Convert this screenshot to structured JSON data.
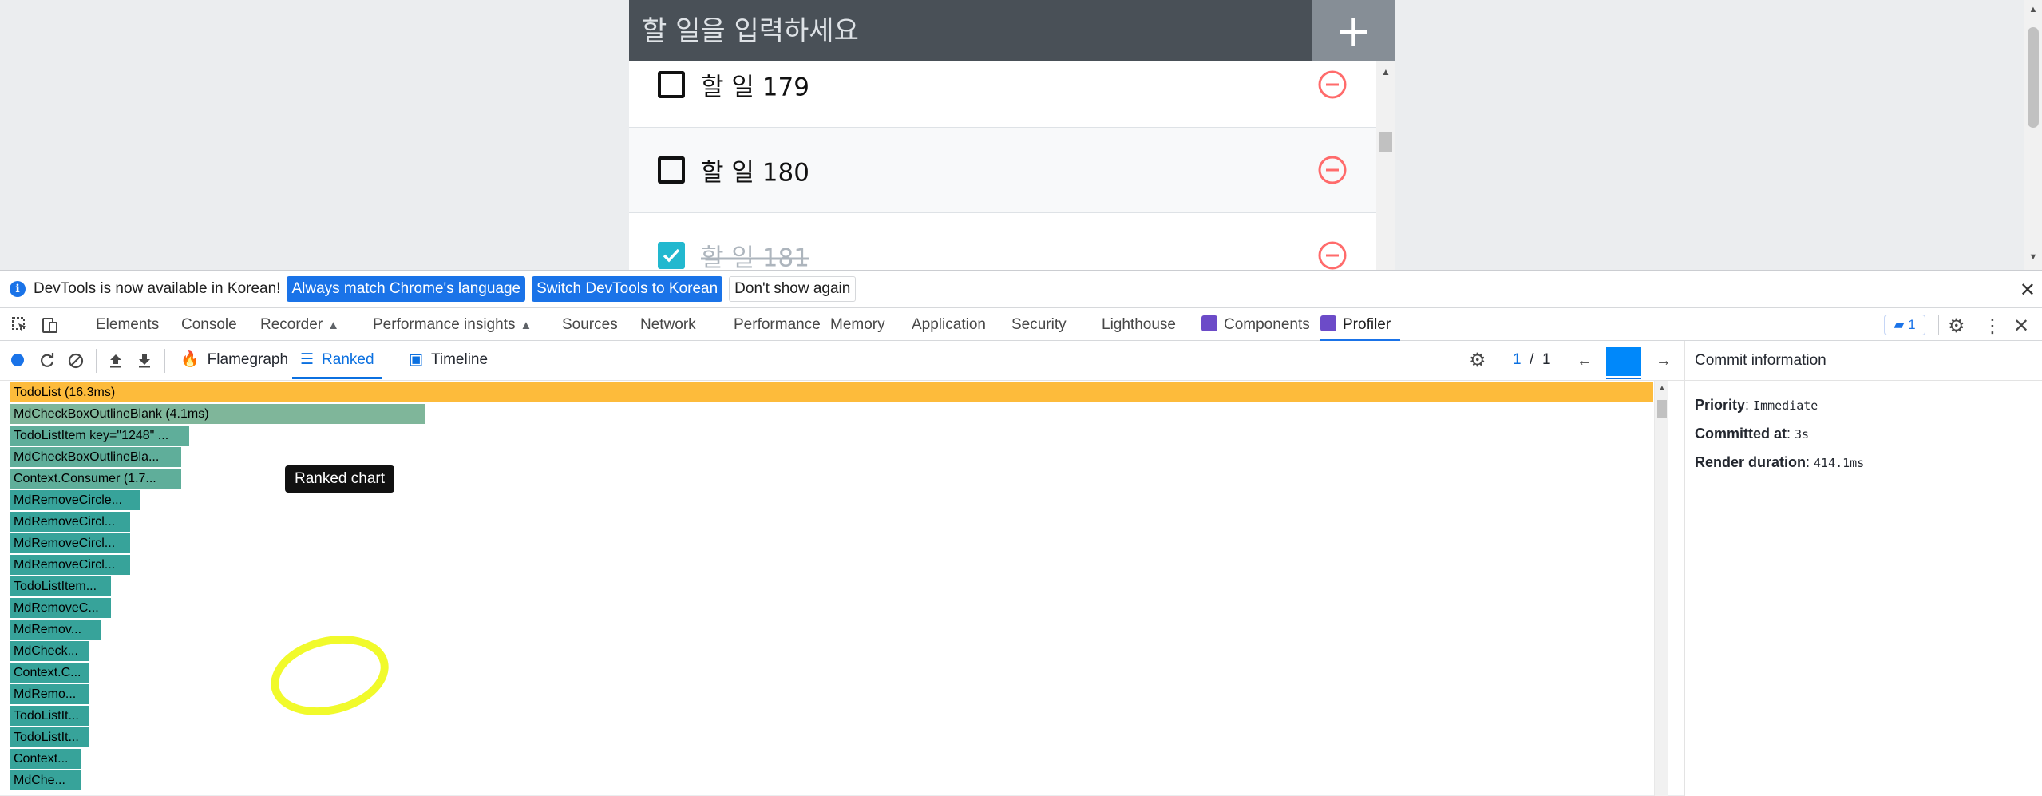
{
  "todo": {
    "placeholder": "할 일을 입력하세요",
    "add_label": "+",
    "items": [
      {
        "text": "할 일 179",
        "checked": false
      },
      {
        "text": "할 일 180",
        "checked": false
      },
      {
        "text": "할 일 181",
        "checked": true
      }
    ]
  },
  "infobar": {
    "message": "DevTools is now available in Korean!",
    "match_label": "Always match Chrome's language",
    "switch_label": "Switch DevTools to Korean",
    "dismiss_label": "Don't show again",
    "close_label": "✕"
  },
  "devtools_tabs": {
    "elements": "Elements",
    "console": "Console",
    "recorder": "Recorder",
    "perf_insights": "Performance insights",
    "sources": "Sources",
    "network": "Network",
    "performance": "Performance",
    "memory": "Memory",
    "application": "Application",
    "security": "Security",
    "lighthouse": "Lighthouse",
    "components": "Components",
    "profiler": "Profiler",
    "issues_count": "1",
    "active": "Profiler"
  },
  "profiler": {
    "tabs": {
      "flamegraph": "Flamegraph",
      "ranked": "Ranked",
      "timeline": "Timeline"
    },
    "active_tab": "Ranked",
    "tooltip": "Ranked chart",
    "commit_current": "1",
    "commit_sep": "/",
    "commit_total": "1",
    "commit_bar_color": "#0088fa",
    "ranked_items": [
      {
        "label": "TodoList (16.3ms)",
        "fraction": 1.0
      },
      {
        "label": "MdCheckBoxOutlineBlank (4.1ms)",
        "fraction": 0.252
      },
      {
        "label": "TodoListItem key=\"1248\" ...",
        "fraction": 0.109
      },
      {
        "label": "MdCheckBoxOutlineBla...",
        "fraction": 0.104
      },
      {
        "label": "Context.Consumer (1.7...",
        "fraction": 0.104
      },
      {
        "label": "MdRemoveCircle...",
        "fraction": 0.079
      },
      {
        "label": "MdRemoveCircl...",
        "fraction": 0.073
      },
      {
        "label": "MdRemoveCircl...",
        "fraction": 0.073
      },
      {
        "label": "MdRemoveCircl...",
        "fraction": 0.073
      },
      {
        "label": "TodoListItem...",
        "fraction": 0.061
      },
      {
        "label": "MdRemoveC...",
        "fraction": 0.061
      },
      {
        "label": "MdRemov...",
        "fraction": 0.055
      },
      {
        "label": "MdCheck...",
        "fraction": 0.048
      },
      {
        "label": "Context.C...",
        "fraction": 0.048
      },
      {
        "label": "MdRemo...",
        "fraction": 0.048
      },
      {
        "label": "TodoListIt...",
        "fraction": 0.048
      },
      {
        "label": "TodoListIt...",
        "fraction": 0.048
      },
      {
        "label": "Context...",
        "fraction": 0.043
      },
      {
        "label": "MdChe...",
        "fraction": 0.043
      }
    ],
    "colors": {
      "top": "#fdbb3b",
      "mid": "#7fb69a",
      "low": "#37a39a"
    }
  },
  "commit_info": {
    "title": "Commit information",
    "priority_label": "Priority",
    "priority_value": "Immediate",
    "committed_label": "Committed at",
    "committed_value": "3s",
    "duration_label": "Render duration",
    "duration_value": "414.1ms"
  }
}
